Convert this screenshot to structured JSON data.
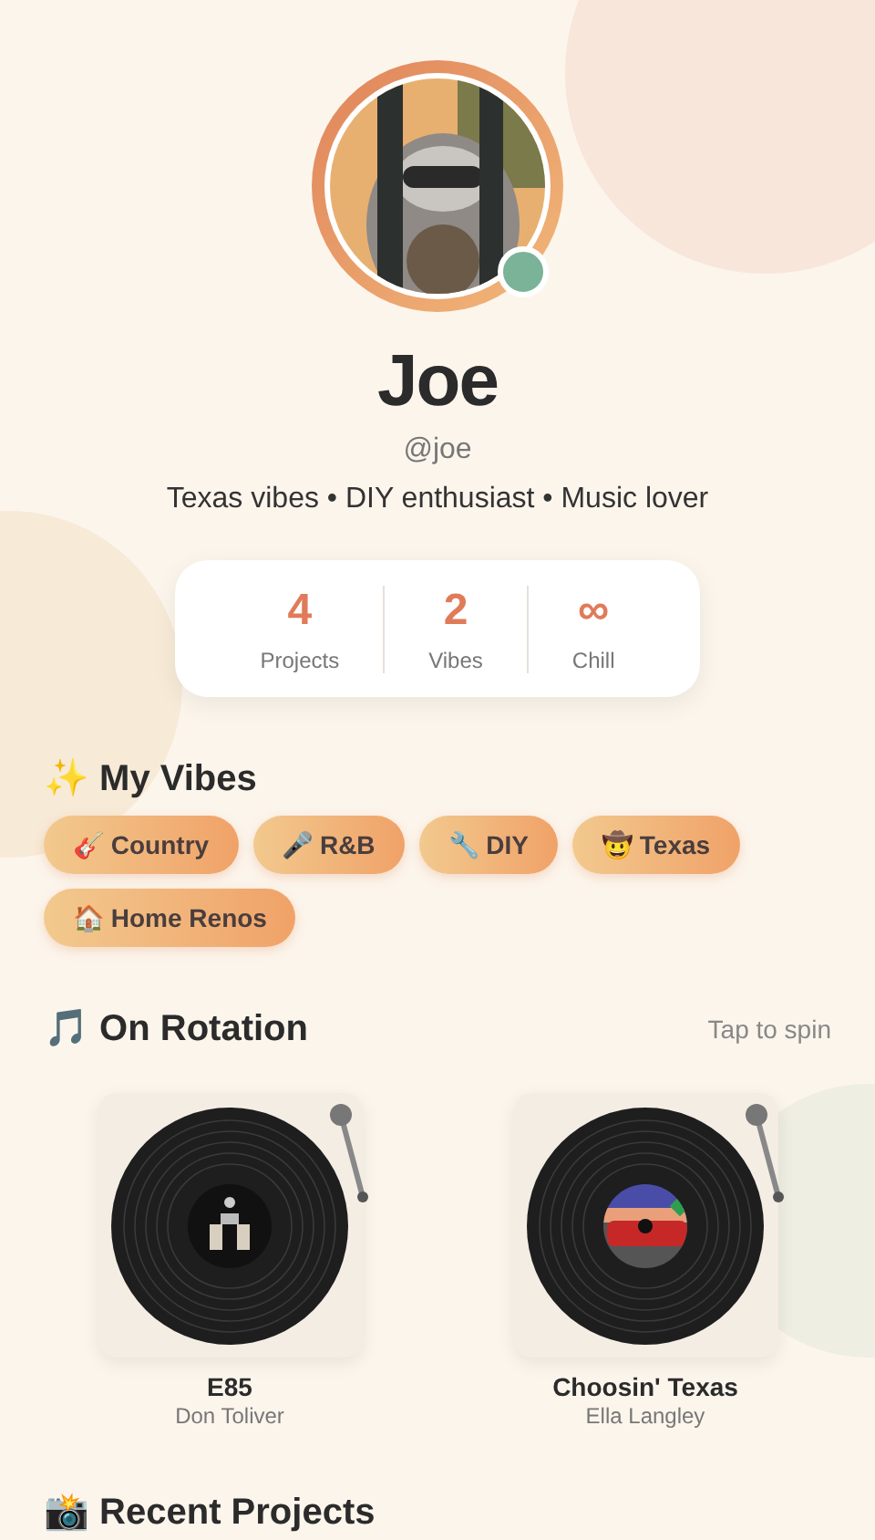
{
  "profile": {
    "name": "Joe",
    "handle": "@joe",
    "bio": "Texas vibes • DIY enthusiast • Music lover",
    "online": true
  },
  "stats": [
    {
      "value": "4",
      "label": "Projects"
    },
    {
      "value": "2",
      "label": "Vibes"
    },
    {
      "value": "∞",
      "label": "Chill"
    }
  ],
  "vibes": {
    "title": "✨ My Vibes",
    "tags": [
      "🎸 Country",
      "🎤 R&B",
      "🔧 DIY",
      "🤠 Texas",
      "🏠 Home Renos"
    ]
  },
  "rotation": {
    "title": "🎵 On Rotation",
    "hint": "Tap to spin",
    "records": [
      {
        "title": "E85",
        "artist": "Don Toliver",
        "kind": "dark"
      },
      {
        "title": "Choosin' Texas",
        "artist": "Ella Langley",
        "kind": "car"
      }
    ]
  },
  "recent": {
    "title": "📸 Recent Projects"
  }
}
